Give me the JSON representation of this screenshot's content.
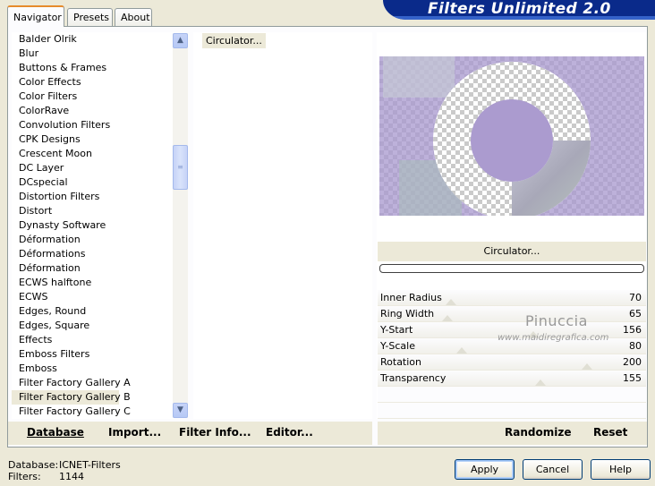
{
  "tabs": [
    "Navigator",
    "Presets",
    "About"
  ],
  "brand": "Filters Unlimited 2.0",
  "categories": [
    "Balder Olrik",
    "Blur",
    "Buttons & Frames",
    "Color Effects",
    "Color Filters",
    "ColorRave",
    "Convolution Filters",
    "CPK Designs",
    "Crescent Moon",
    "DC Layer",
    "DCspecial",
    "Distortion Filters",
    "Distort",
    "Dynasty Software",
    "Déformation",
    "Déformations",
    "Déformation",
    "ECWS halftone",
    "ECWS",
    "Edges, Round",
    "Edges, Square",
    "Effects",
    "Emboss Filters",
    "Emboss",
    "Filter Factory Gallery A",
    "Filter Factory Gallery B",
    "Filter Factory Gallery C"
  ],
  "selected_category": "Filter Factory Gallery B",
  "filters": [
    "Circulator..."
  ],
  "filter_name": "Circulator...",
  "params": [
    {
      "label": "Inner Radius",
      "value": "70"
    },
    {
      "label": "Ring Width",
      "value": "65"
    },
    {
      "label": "Y-Start",
      "value": "156"
    },
    {
      "label": "Y-Scale",
      "value": "80"
    },
    {
      "label": "Rotation",
      "value": "200"
    },
    {
      "label": "Transparency",
      "value": "155"
    }
  ],
  "watermark": {
    "line1": "Pinuccia",
    "line2": "www.maidiregrafica.com"
  },
  "buttons": {
    "database": "Database",
    "import": "Import...",
    "filter_info": "Filter Info...",
    "editor": "Editor...",
    "randomize": "Randomize",
    "reset": "Reset",
    "apply": "Apply",
    "cancel": "Cancel",
    "help": "Help"
  },
  "status": {
    "database_label": "Database:",
    "database_value": "ICNET-Filters",
    "filters_label": "Filters:",
    "filters_value": "1144"
  },
  "colors": {
    "preview_purple": "#ab9bcf",
    "preview_ring": "#ffffff",
    "banner_blue": "#0a2a8a"
  }
}
